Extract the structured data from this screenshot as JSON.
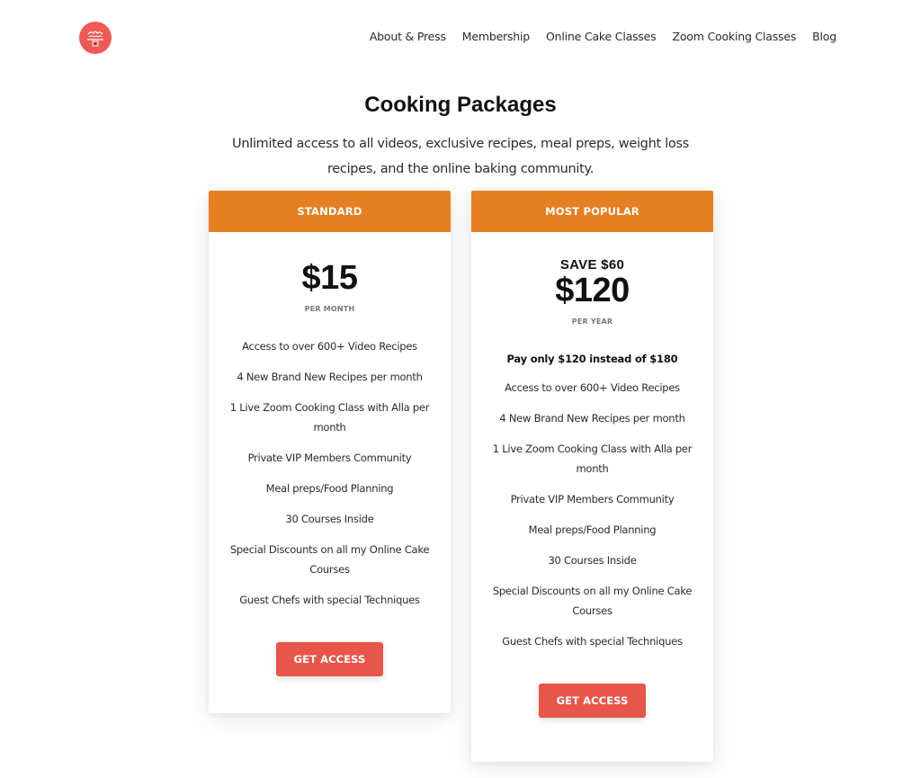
{
  "header": {
    "logo_icon": "cake-logo-icon",
    "nav": [
      {
        "label": "About & Press"
      },
      {
        "label": "Membership"
      },
      {
        "label": "Online Cake Classes"
      },
      {
        "label": "Zoom Cooking Classes"
      },
      {
        "label": "Blog"
      }
    ]
  },
  "main": {
    "title": "Cooking Packages",
    "subtitle": "Unlimited access to all videos, exclusive recipes, meal preps, weight loss recipes, and the online baking community."
  },
  "plans": [
    {
      "header": "STANDARD",
      "price": "$15",
      "period": "PER MONTH",
      "features": [
        "Access to over 600+ Video Recipes",
        "4 New Brand New Recipes per month",
        "1 Live Zoom Cooking Class with Alla per month",
        "Private VIP Members Community",
        "Meal preps/Food Planning",
        "30 Courses Inside",
        "Special Discounts on all my Online Cake Courses",
        "Guest Chefs with special Techniques"
      ],
      "button": "GET ACCESS"
    },
    {
      "header": "MOST POPULAR",
      "save": "SAVE $60",
      "price": "$120",
      "period": "PER YEAR",
      "highlight": "Pay only $120 instead of $180",
      "features": [
        "Access to over 600+ Video Recipes",
        "4 New Brand New Recipes per month",
        "1 Live Zoom Cooking Class with Alla per month",
        "Private VIP Members Community",
        "Meal preps/Food Planning",
        "30 Courses Inside",
        "Special Discounts on all my Online Cake Courses",
        "Guest Chefs with special Techniques"
      ],
      "button": "GET ACCESS"
    }
  ],
  "colors": {
    "header_orange": "#e57f22",
    "button_red": "#e8554a",
    "logo_red": "#ee5a55"
  }
}
